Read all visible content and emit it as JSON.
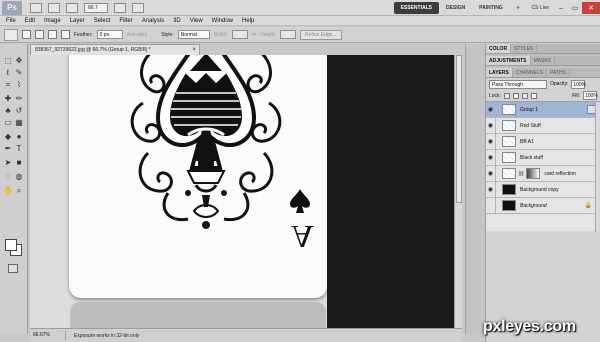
{
  "app": {
    "logo": "Ps",
    "zoom_value": "66.7",
    "workspaces": [
      "ESSENTIALS",
      "DESIGN",
      "PAINTING"
    ],
    "cs_live": "CS Live",
    "win_minimize": "–",
    "win_restore": "▭",
    "win_close": "✕"
  },
  "menu": [
    "File",
    "Edit",
    "Image",
    "Layer",
    "Select",
    "Filter",
    "Analysis",
    "3D",
    "View",
    "Window",
    "Help"
  ],
  "options": {
    "feather_label": "Feather:",
    "feather_value": "0 px",
    "antialias_label": "Anti-alias",
    "style_label": "Style:",
    "style_value": "Normal",
    "width_label": "Width:",
    "height_label": "Height:",
    "refine_edge": "Refine Edge..."
  },
  "document": {
    "tab_title": "838367_92739622.jpg @ 66.7% (Group 1, RGB/8) *",
    "tab_close": "×",
    "status_zoom": "66.67%",
    "status_text": "Exposure works in 32-bit only",
    "card_letter": "A"
  },
  "panels": {
    "top_tabs": [
      "COLOR",
      "STYLES"
    ],
    "mid_tabs": [
      "ADJUSTMENTS",
      "MASKS"
    ],
    "layer_tabs": [
      "LAYERS",
      "CHANNELS",
      "PATHS"
    ],
    "blend_mode": "Pass Through",
    "opacity_label": "Opacity:",
    "opacity_value": "100%",
    "lock_label": "Lock:",
    "fill_label": "Fill:",
    "fill_value": "100%",
    "layers": [
      {
        "name": "Group 1",
        "thumb": "checker",
        "selected": true
      },
      {
        "name": "Red Stuff",
        "thumb": "checker",
        "selected": false
      },
      {
        "name": "BB A1",
        "thumb": "checker",
        "selected": false
      },
      {
        "name": "Black stuff",
        "thumb": "checker",
        "selected": false
      },
      {
        "name": "card reflection",
        "thumb": "checker",
        "selected": false
      },
      {
        "name": "Background copy",
        "thumb": "bgcopy",
        "selected": false
      },
      {
        "name": "Background",
        "thumb": "white",
        "selected": false
      }
    ]
  },
  "watermark": "pxleyes.com"
}
